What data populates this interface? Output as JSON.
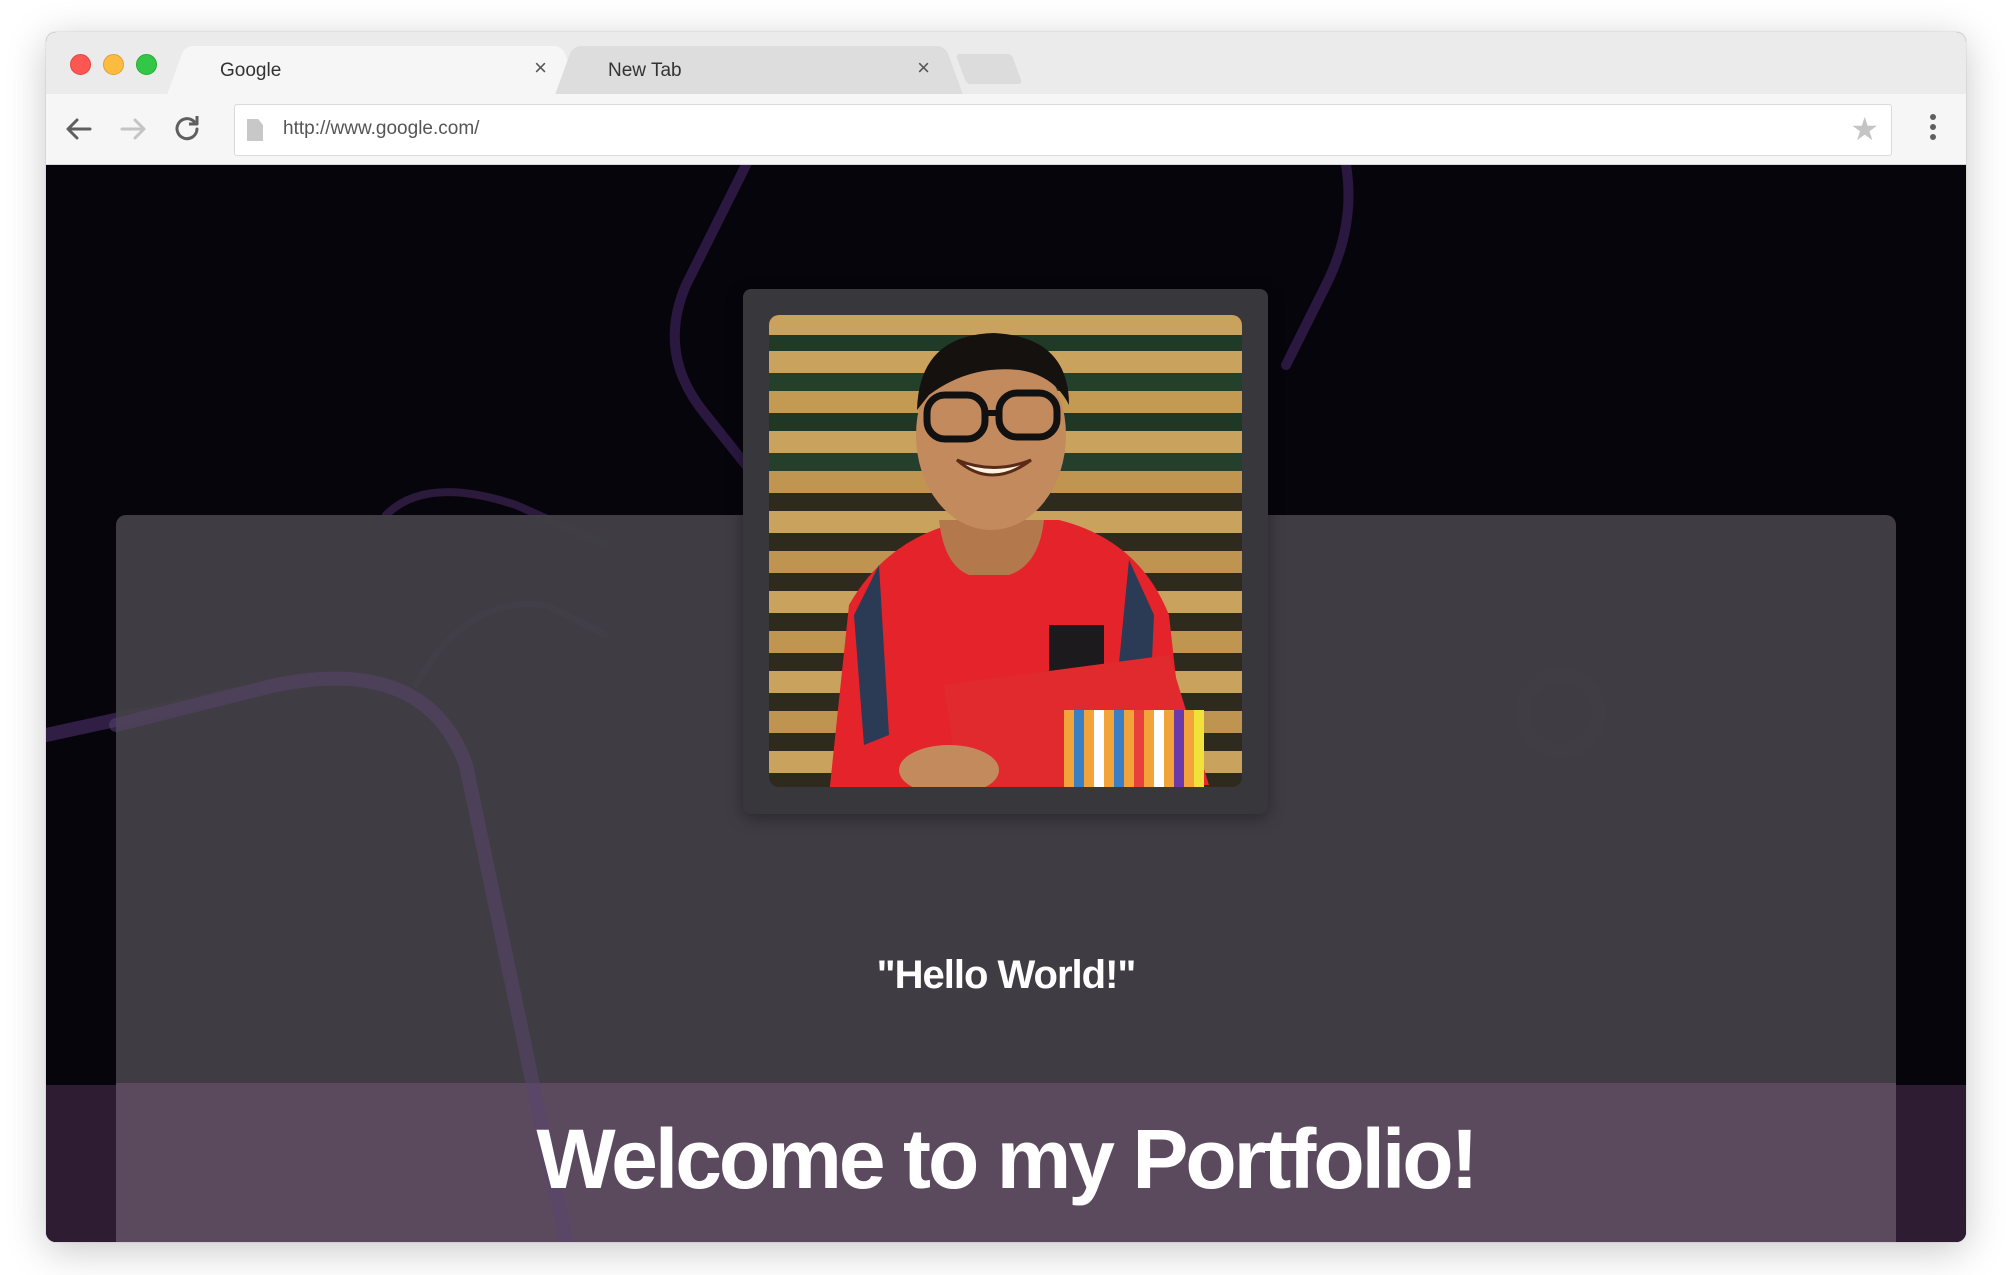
{
  "browser": {
    "tabs": [
      {
        "label": "Google",
        "close": "×",
        "active": true
      },
      {
        "label": "New Tab",
        "close": "×",
        "active": false
      }
    ],
    "url": "http://www.google.com/",
    "icons": {
      "back": "back-arrow-icon",
      "forward": "forward-arrow-icon",
      "reload": "reload-icon",
      "bookmark": "star-icon",
      "menu": "kebab-menu-icon",
      "page": "page-icon"
    }
  },
  "page": {
    "greeting": "\"Hello World!\"",
    "headline": "Welcome to my Portfolio!",
    "photo": "profile-photo"
  },
  "colors": {
    "page_background": "#07050c",
    "card": "#424046",
    "accent_band": "#5b4a5e",
    "decor_line": "#3b2453"
  }
}
